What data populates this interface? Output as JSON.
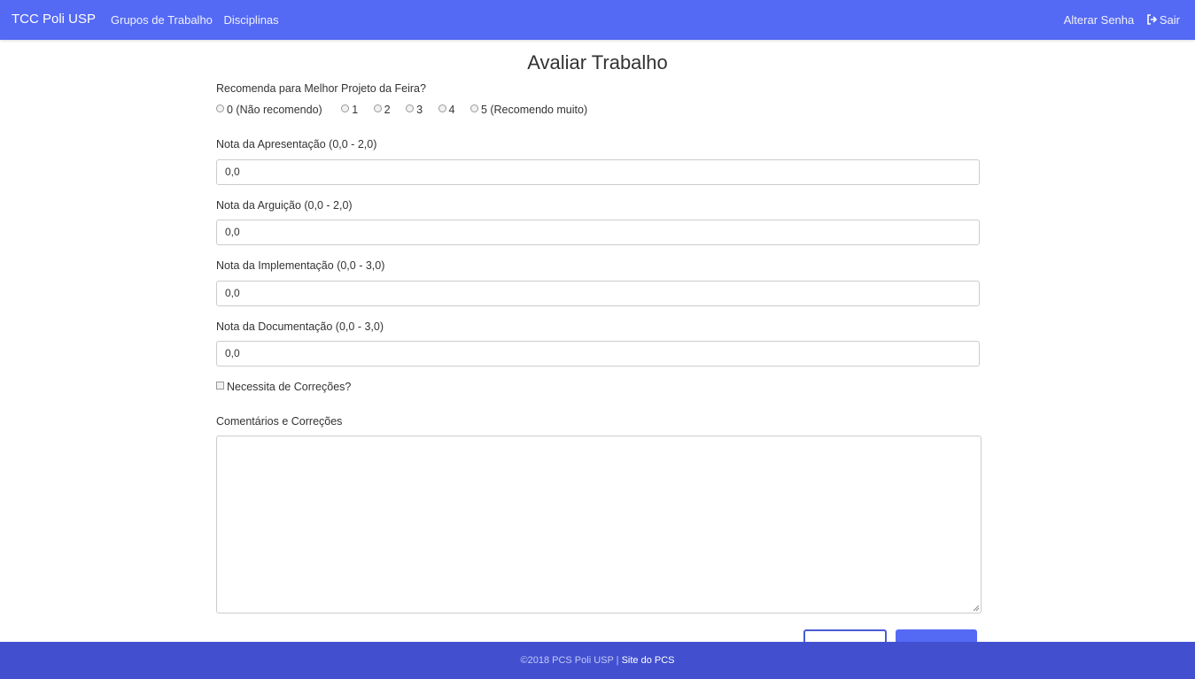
{
  "navbar": {
    "brand": "TCC Poli USP",
    "links": [
      "Grupos de Trabalho",
      "Disciplinas"
    ],
    "change_password": "Alterar Senha",
    "logout": "Sair",
    "logout_icon": "sign-out-icon",
    "color": "#5469f4"
  },
  "form": {
    "title": "Avaliar Trabalho",
    "recommend_label": "Recomenda para Melhor Projeto da Feira?",
    "recommend_options": [
      "0 (Não recomendo)",
      "1",
      "2",
      "3",
      "4",
      "5 (Recomendo muito)"
    ],
    "presentation": {
      "label": "Nota da Apresentação (0,0 - 2,0)",
      "value": "0,0"
    },
    "arguicao": {
      "label": "Nota da Arguição (0,0 - 2,0)",
      "value": "0,0"
    },
    "implementation": {
      "label": "Nota da Implementação (0,0 - 3,0)",
      "value": "0,0"
    },
    "documentation": {
      "label": "Nota da Documentação (0,0 - 3,0)",
      "value": "0,0"
    },
    "needs_corrections": "Necessita de Correções?",
    "comments_label": "Comentários e Correções",
    "comments_value": ""
  },
  "footer": {
    "copyright": "©2018 PCS Poli USP | ",
    "link": "Site do PCS",
    "color": "#4250d0"
  }
}
